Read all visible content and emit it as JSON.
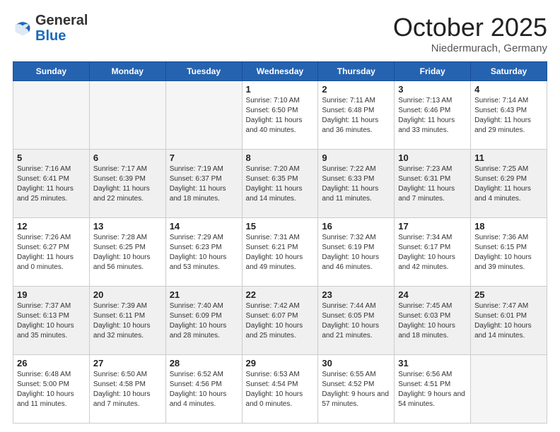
{
  "header": {
    "logo_general": "General",
    "logo_blue": "Blue",
    "month_title": "October 2025",
    "location": "Niedermurach, Germany"
  },
  "days_of_week": [
    "Sunday",
    "Monday",
    "Tuesday",
    "Wednesday",
    "Thursday",
    "Friday",
    "Saturday"
  ],
  "weeks": [
    [
      {
        "day": "",
        "info": ""
      },
      {
        "day": "",
        "info": ""
      },
      {
        "day": "",
        "info": ""
      },
      {
        "day": "1",
        "info": "Sunrise: 7:10 AM\nSunset: 6:50 PM\nDaylight: 11 hours and 40 minutes."
      },
      {
        "day": "2",
        "info": "Sunrise: 7:11 AM\nSunset: 6:48 PM\nDaylight: 11 hours and 36 minutes."
      },
      {
        "day": "3",
        "info": "Sunrise: 7:13 AM\nSunset: 6:46 PM\nDaylight: 11 hours and 33 minutes."
      },
      {
        "day": "4",
        "info": "Sunrise: 7:14 AM\nSunset: 6:43 PM\nDaylight: 11 hours and 29 minutes."
      }
    ],
    [
      {
        "day": "5",
        "info": "Sunrise: 7:16 AM\nSunset: 6:41 PM\nDaylight: 11 hours and 25 minutes."
      },
      {
        "day": "6",
        "info": "Sunrise: 7:17 AM\nSunset: 6:39 PM\nDaylight: 11 hours and 22 minutes."
      },
      {
        "day": "7",
        "info": "Sunrise: 7:19 AM\nSunset: 6:37 PM\nDaylight: 11 hours and 18 minutes."
      },
      {
        "day": "8",
        "info": "Sunrise: 7:20 AM\nSunset: 6:35 PM\nDaylight: 11 hours and 14 minutes."
      },
      {
        "day": "9",
        "info": "Sunrise: 7:22 AM\nSunset: 6:33 PM\nDaylight: 11 hours and 11 minutes."
      },
      {
        "day": "10",
        "info": "Sunrise: 7:23 AM\nSunset: 6:31 PM\nDaylight: 11 hours and 7 minutes."
      },
      {
        "day": "11",
        "info": "Sunrise: 7:25 AM\nSunset: 6:29 PM\nDaylight: 11 hours and 4 minutes."
      }
    ],
    [
      {
        "day": "12",
        "info": "Sunrise: 7:26 AM\nSunset: 6:27 PM\nDaylight: 11 hours and 0 minutes."
      },
      {
        "day": "13",
        "info": "Sunrise: 7:28 AM\nSunset: 6:25 PM\nDaylight: 10 hours and 56 minutes."
      },
      {
        "day": "14",
        "info": "Sunrise: 7:29 AM\nSunset: 6:23 PM\nDaylight: 10 hours and 53 minutes."
      },
      {
        "day": "15",
        "info": "Sunrise: 7:31 AM\nSunset: 6:21 PM\nDaylight: 10 hours and 49 minutes."
      },
      {
        "day": "16",
        "info": "Sunrise: 7:32 AM\nSunset: 6:19 PM\nDaylight: 10 hours and 46 minutes."
      },
      {
        "day": "17",
        "info": "Sunrise: 7:34 AM\nSunset: 6:17 PM\nDaylight: 10 hours and 42 minutes."
      },
      {
        "day": "18",
        "info": "Sunrise: 7:36 AM\nSunset: 6:15 PM\nDaylight: 10 hours and 39 minutes."
      }
    ],
    [
      {
        "day": "19",
        "info": "Sunrise: 7:37 AM\nSunset: 6:13 PM\nDaylight: 10 hours and 35 minutes."
      },
      {
        "day": "20",
        "info": "Sunrise: 7:39 AM\nSunset: 6:11 PM\nDaylight: 10 hours and 32 minutes."
      },
      {
        "day": "21",
        "info": "Sunrise: 7:40 AM\nSunset: 6:09 PM\nDaylight: 10 hours and 28 minutes."
      },
      {
        "day": "22",
        "info": "Sunrise: 7:42 AM\nSunset: 6:07 PM\nDaylight: 10 hours and 25 minutes."
      },
      {
        "day": "23",
        "info": "Sunrise: 7:44 AM\nSunset: 6:05 PM\nDaylight: 10 hours and 21 minutes."
      },
      {
        "day": "24",
        "info": "Sunrise: 7:45 AM\nSunset: 6:03 PM\nDaylight: 10 hours and 18 minutes."
      },
      {
        "day": "25",
        "info": "Sunrise: 7:47 AM\nSunset: 6:01 PM\nDaylight: 10 hours and 14 minutes."
      }
    ],
    [
      {
        "day": "26",
        "info": "Sunrise: 6:48 AM\nSunset: 5:00 PM\nDaylight: 10 hours and 11 minutes."
      },
      {
        "day": "27",
        "info": "Sunrise: 6:50 AM\nSunset: 4:58 PM\nDaylight: 10 hours and 7 minutes."
      },
      {
        "day": "28",
        "info": "Sunrise: 6:52 AM\nSunset: 4:56 PM\nDaylight: 10 hours and 4 minutes."
      },
      {
        "day": "29",
        "info": "Sunrise: 6:53 AM\nSunset: 4:54 PM\nDaylight: 10 hours and 0 minutes."
      },
      {
        "day": "30",
        "info": "Sunrise: 6:55 AM\nSunset: 4:52 PM\nDaylight: 9 hours and 57 minutes."
      },
      {
        "day": "31",
        "info": "Sunrise: 6:56 AM\nSunset: 4:51 PM\nDaylight: 9 hours and 54 minutes."
      },
      {
        "day": "",
        "info": ""
      }
    ]
  ]
}
